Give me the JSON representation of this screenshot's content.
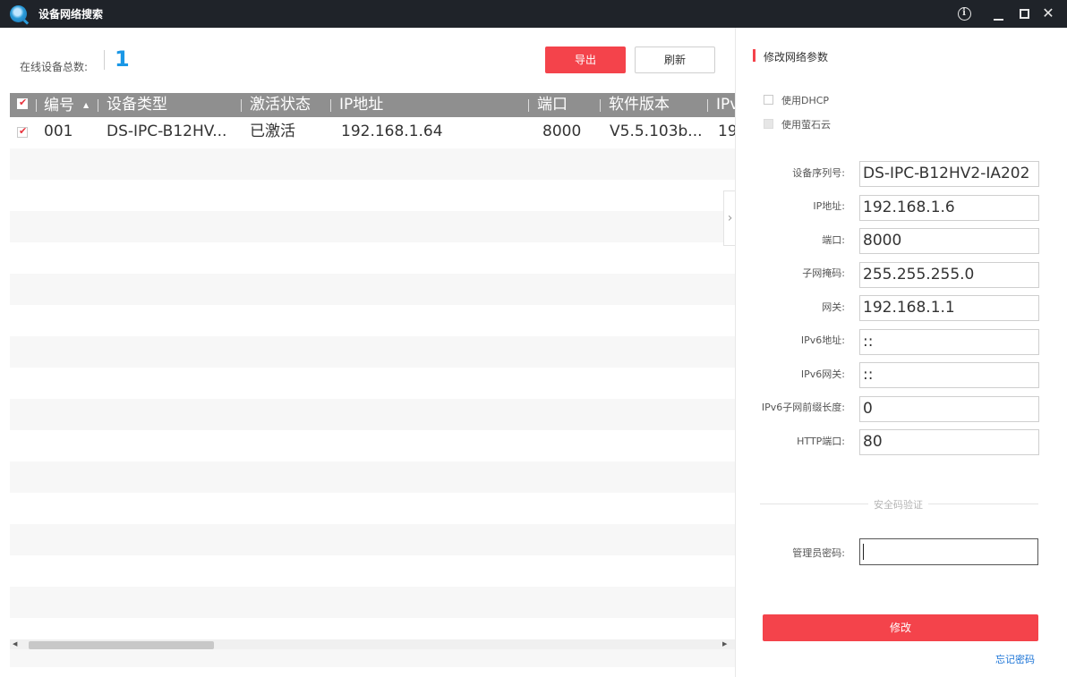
{
  "window": {
    "title": "设备网络搜索",
    "icons": [
      "search-app-icon",
      "info-icon",
      "minimize-icon",
      "maximize-icon",
      "close-icon"
    ]
  },
  "toolbar": {
    "count_label": "在线设备总数:",
    "count_value": "1",
    "export_label": "导出",
    "refresh_label": "刷新"
  },
  "table": {
    "columns": [
      "编号",
      "设备类型",
      "激活状态",
      "IP地址",
      "端口",
      "软件版本",
      "IPv"
    ],
    "rows": [
      {
        "checked": true,
        "cells": [
          "001",
          "DS-IPC-B12HV...",
          "已激活",
          "192.168.1.64",
          "8000",
          "V5.5.103b...",
          "19"
        ]
      }
    ]
  },
  "panel": {
    "title": "修改网络参数",
    "use_dhcp": "使用DHCP",
    "use_ezviz": "使用萤石云",
    "fields": [
      {
        "label": "设备序列号:",
        "value": "DS-IPC-B12HV2-IA202"
      },
      {
        "label": "IP地址:",
        "value": "192.168.1.6"
      },
      {
        "label": "端口:",
        "value": "8000"
      },
      {
        "label": "子网掩码:",
        "value": "255.255.255.0"
      },
      {
        "label": "网关:",
        "value": "192.168.1.1"
      },
      {
        "label": "IPv6地址:",
        "value": "::"
      },
      {
        "label": "IPv6网关:",
        "value": "::"
      },
      {
        "label": "IPv6子网前缀长度:",
        "value": "0"
      },
      {
        "label": "HTTP端口:",
        "value": "80"
      }
    ],
    "security_divider": "安全码验证",
    "admin_password_label": "管理员密码:",
    "admin_password_value": "",
    "modify_label": "修改",
    "forgot_label": "忘记密码"
  },
  "colors": {
    "accent": "#f4434b",
    "titlebar": "#1f2329",
    "header": "#8f8f8f",
    "count": "#1a97e6",
    "link": "#1a73d6"
  }
}
